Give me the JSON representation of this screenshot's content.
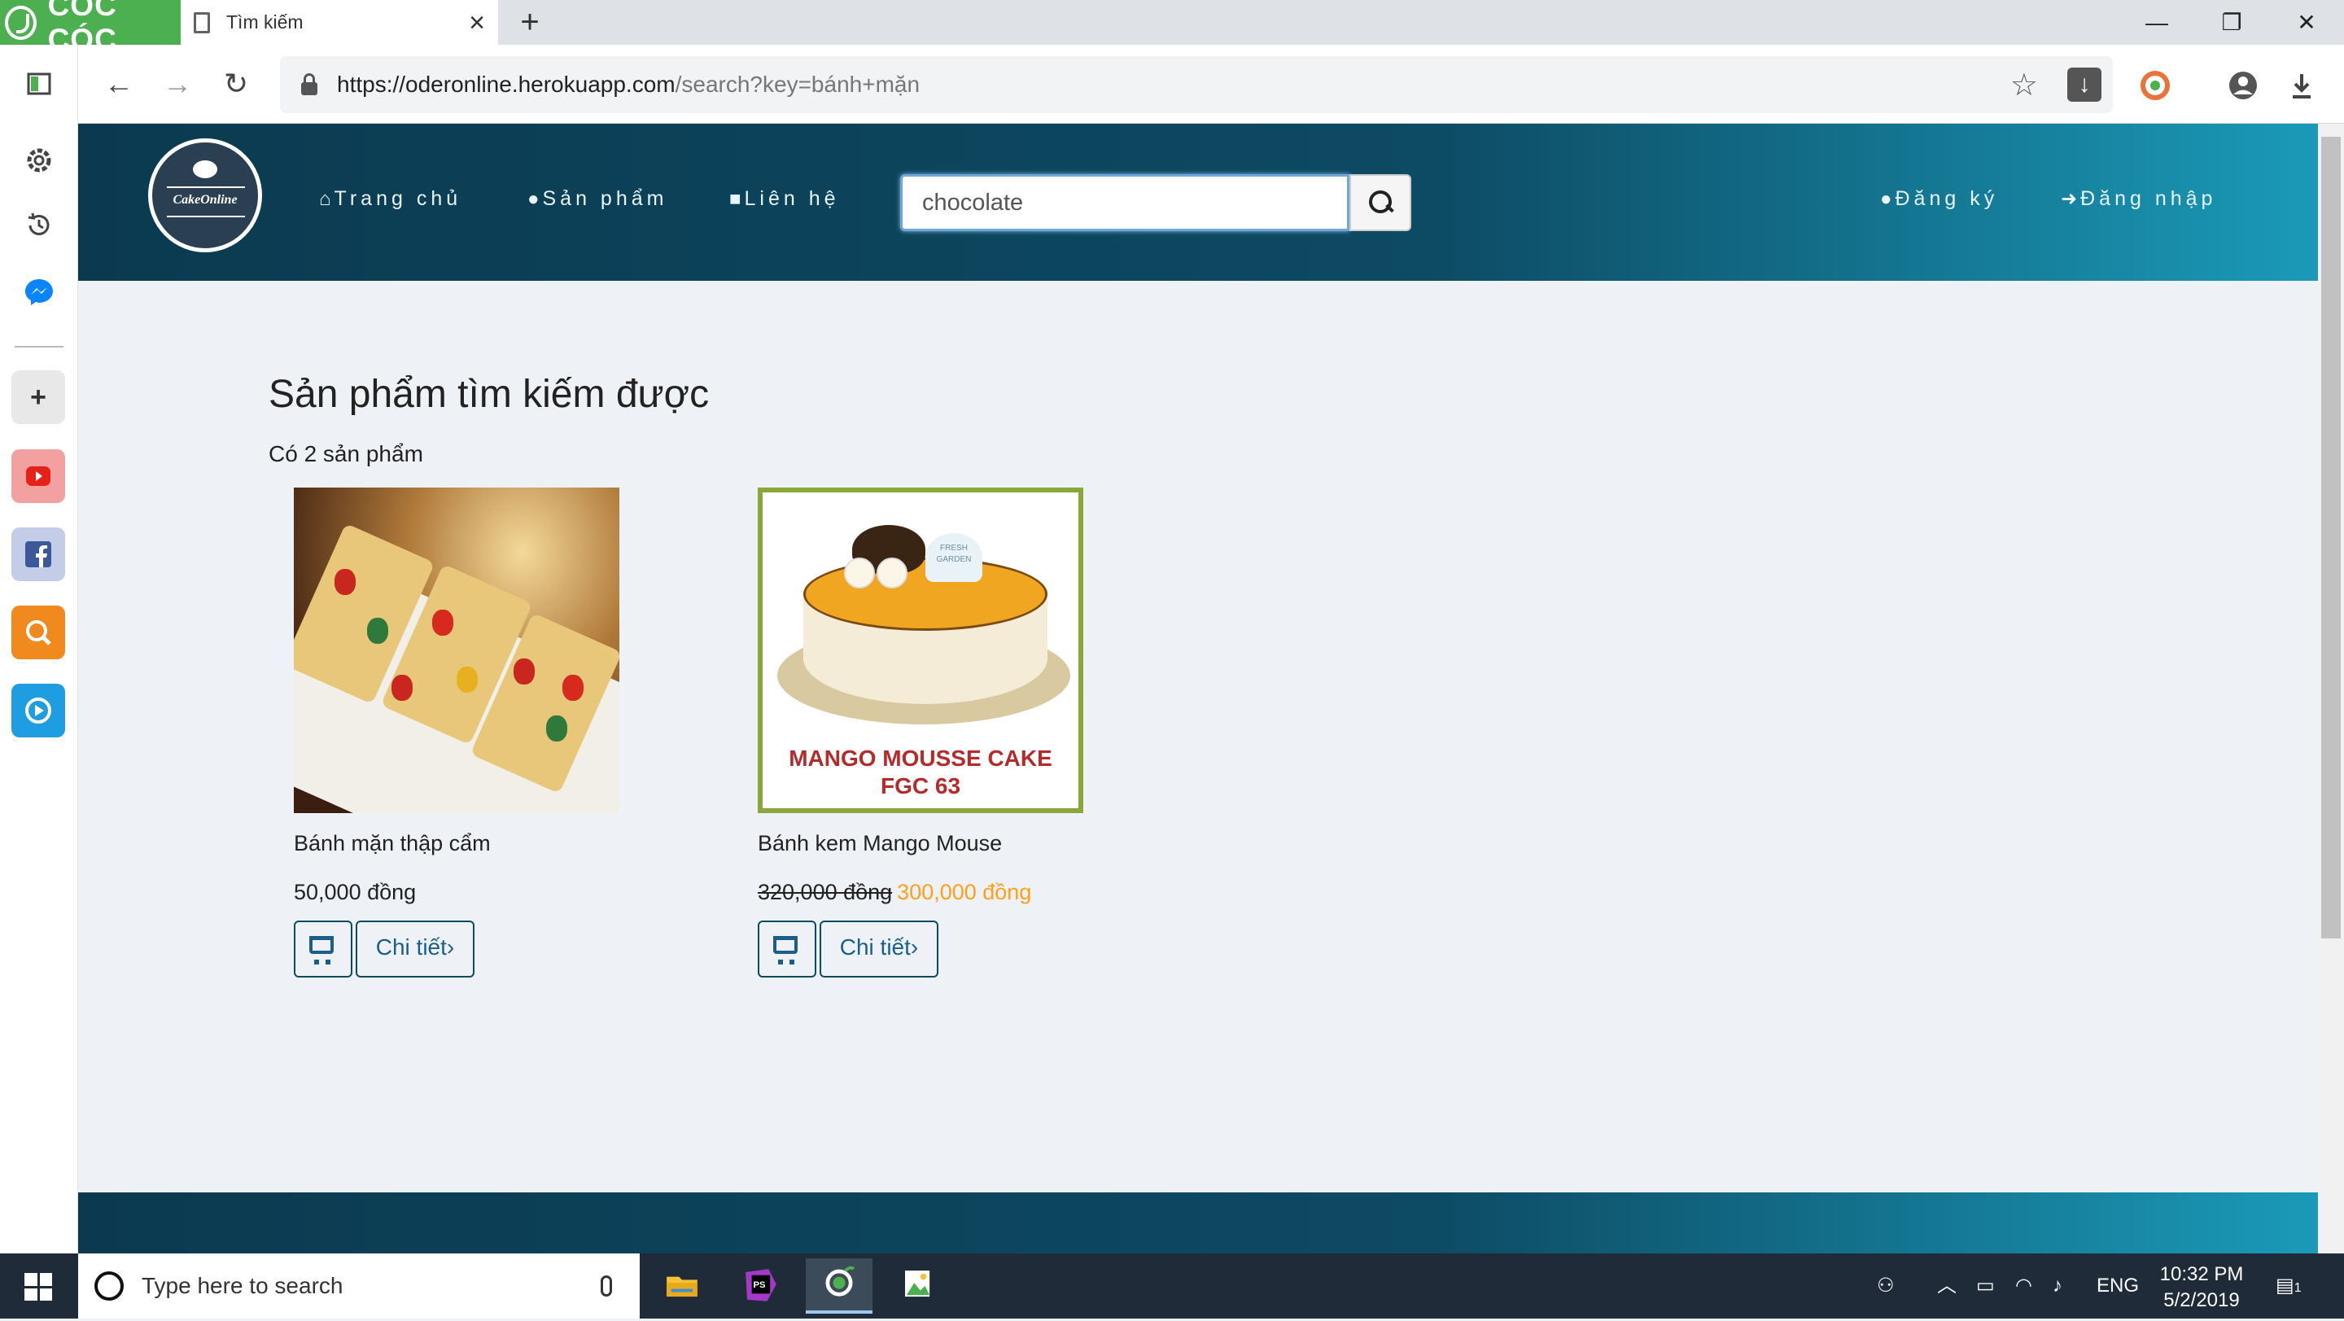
{
  "browser": {
    "brand": "CÓC CÓC",
    "tab_title": "Tìm kiếm",
    "url_host": "https://oderonline.herokuapp.com",
    "url_path": "/search?key=bánh+mặn",
    "new_tab_symbol": "+",
    "window_controls": {
      "minimize": "—",
      "restore": "❐",
      "close": "✕"
    },
    "nav": {
      "back": "←",
      "forward": "→",
      "reload": "↻"
    },
    "brand_color": "#4caf50"
  },
  "sidebar": {
    "icons": [
      "sidebar-toggle-icon",
      "settings-icon",
      "history-icon",
      "messenger-icon",
      "add-icon",
      "youtube-icon",
      "facebook-icon",
      "search-app-icon",
      "media-player-icon"
    ],
    "add_symbol": "+"
  },
  "site": {
    "logo_text": "CakeOnline",
    "nav": {
      "home": "Trang chủ",
      "products": "Sản phẩm",
      "contact": "Liên hệ",
      "register": "Đăng ký",
      "login": "Đăng nhập"
    },
    "search_value": "chocolate",
    "navbar_colors": [
      "#0b3a50",
      "#0d4a63",
      "#1a9ab8"
    ]
  },
  "results": {
    "title": "Sản phẩm tìm kiếm được",
    "count_text": "Có 2 sản phẩm",
    "detail_label": "Chi tiết",
    "products": [
      {
        "name": "Bánh mặn thập cẩm",
        "price": "50,000 đồng",
        "old_price": "",
        "sale_price": ""
      },
      {
        "name": "Bánh kem Mango Mouse",
        "price": "",
        "old_price": "320,000 đồng",
        "sale_price": "300,000 đồng",
        "image_caption_1": "MANGO MOUSSE CAKE",
        "image_caption_2": "FGC 63",
        "image_brand": "FRESH GARDEN"
      }
    ],
    "sale_color": "#ff9f1a"
  },
  "taskbar": {
    "search_placeholder": "Type here to search",
    "apps": [
      "file-explorer-icon",
      "phpstorm-icon",
      "coccoc-browser-icon",
      "image-viewer-icon"
    ],
    "language": "ENG",
    "time": "10:32 PM",
    "date": "5/2/2019",
    "notification_count": "1"
  }
}
